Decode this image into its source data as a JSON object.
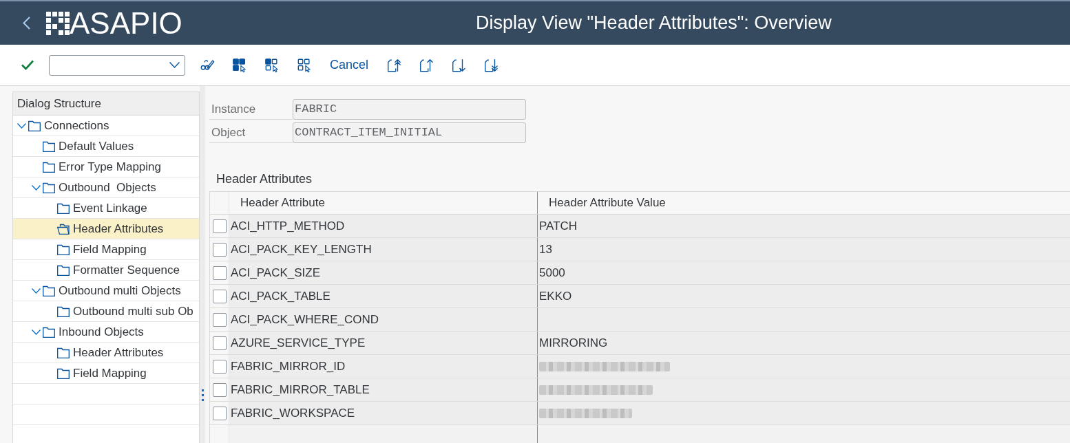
{
  "header": {
    "logo": "ASAPIO",
    "title": "Display View \"Header Attributes\": Overview"
  },
  "toolbar": {
    "cancel": "Cancel"
  },
  "dialog_structure": {
    "title": "Dialog Structure",
    "items": [
      {
        "label": "Connections",
        "expanded": true,
        "selected": false,
        "children": [
          {
            "label": "Default Values",
            "selected": false
          },
          {
            "label": "Error Type Mapping",
            "selected": false
          },
          {
            "label": "Outbound  Objects",
            "expanded": true,
            "selected": false,
            "children": [
              {
                "label": "Event Linkage",
                "selected": false
              },
              {
                "label": "Header Attributes",
                "selected": true
              },
              {
                "label": "Field Mapping",
                "selected": false
              },
              {
                "label": "Formatter Sequence",
                "selected": false
              }
            ]
          },
          {
            "label": "Outbound multi Objects",
            "expanded": true,
            "selected": false,
            "children": [
              {
                "label": "Outbound multi sub Ob",
                "selected": false
              }
            ]
          },
          {
            "label": "Inbound Objects",
            "expanded": true,
            "selected": false,
            "children": [
              {
                "label": "Header Attributes",
                "selected": false
              },
              {
                "label": "Field Mapping",
                "selected": false
              }
            ]
          }
        ]
      }
    ]
  },
  "fields": [
    {
      "label": "Instance",
      "value": "FABRIC"
    },
    {
      "label": "Object",
      "value": "CONTRACT_ITEM_INITIAL"
    }
  ],
  "table": {
    "title": "Header Attributes",
    "columns": [
      "Header Attribute",
      "Header Attribute Value"
    ],
    "rows": [
      {
        "attribute": "ACI_HTTP_METHOD",
        "value": "PATCH",
        "selected": false
      },
      {
        "attribute": "ACI_PACK_KEY_LENGTH",
        "value": "13",
        "selected": false
      },
      {
        "attribute": "ACI_PACK_SIZE",
        "value": "5000",
        "selected": false
      },
      {
        "attribute": "ACI_PACK_TABLE",
        "value": "EKKO",
        "selected": false
      },
      {
        "attribute": "ACI_PACK_WHERE_COND",
        "selected": false
      },
      {
        "attribute": "AZURE_SERVICE_TYPE",
        "value": "MIRRORING",
        "selected": false
      },
      {
        "attribute": "FABRIC_MIRROR_ID",
        "redacted": true,
        "selected": false
      },
      {
        "attribute": "FABRIC_MIRROR_TABLE",
        "redacted": true,
        "selected": false
      },
      {
        "attribute": "FABRIC_WORKSPACE",
        "redacted": true,
        "selected": false
      }
    ]
  }
}
